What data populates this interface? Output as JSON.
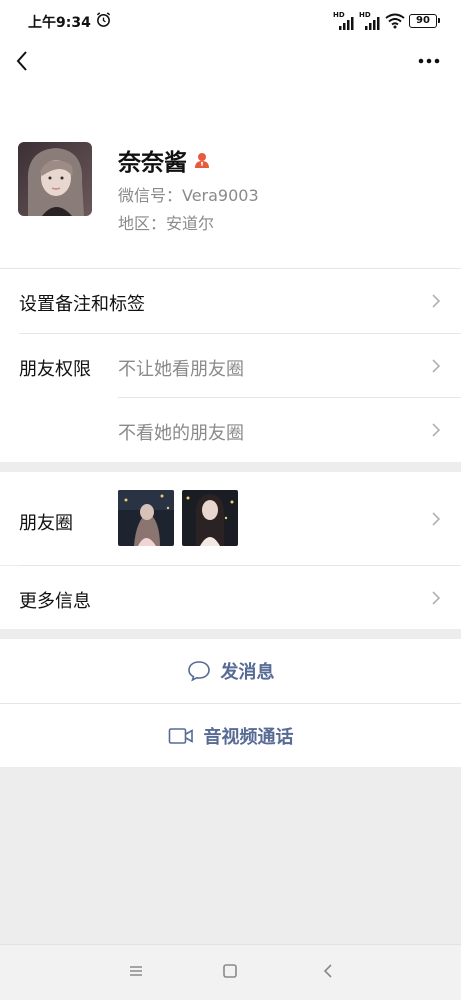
{
  "status": {
    "time": "上午9:34",
    "signal1_label": "HD",
    "signal2_label": "HD",
    "battery": "90"
  },
  "profile": {
    "name": "奈奈酱",
    "wechat_id": "微信号：Vera9003",
    "region": "地区：安道尔"
  },
  "rows": {
    "remark_tags": "设置备注和标签",
    "friend_perm_label": "朋友权限",
    "hide_my_moments": "不让她看朋友圈",
    "hide_her_moments": "不看她的朋友圈",
    "moments_label": "朋友圈",
    "more_info": "更多信息"
  },
  "actions": {
    "send_message": "发消息",
    "video_call": "音视频通话"
  },
  "colors": {
    "accent": "#576b95",
    "badge": "#e9593d"
  },
  "icons": [
    "alarm-icon",
    "signal-icon",
    "wifi-icon",
    "battery-icon",
    "back-icon",
    "more-icon",
    "person-icon",
    "chevron-right-icon",
    "message-bubble-icon",
    "video-camera-icon",
    "menu-icon",
    "home-icon",
    "back-nav-icon"
  ]
}
